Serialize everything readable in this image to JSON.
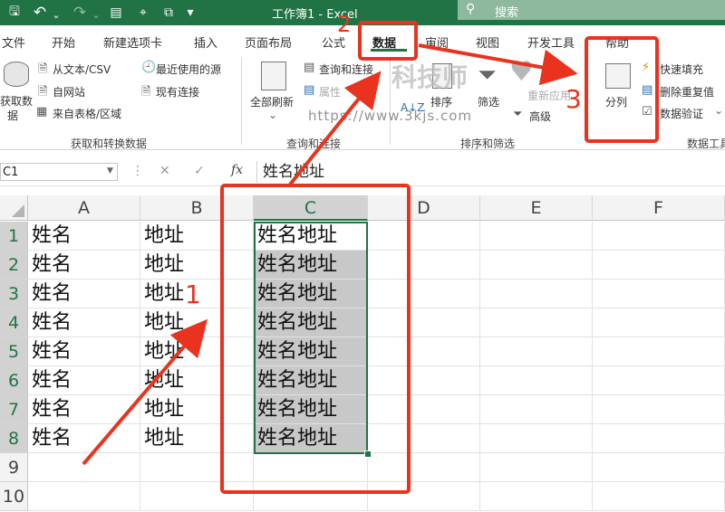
{
  "titlebar": {
    "title": "工作簿1 - Excel",
    "search_placeholder": "搜索",
    "icons": [
      "save-icon",
      "undo-icon",
      "redo-icon",
      "form-icon",
      "camera-icon",
      "screenshot-icon",
      "qat-dropdown-icon",
      "search-icon"
    ],
    "undo_glyph": "↶",
    "redo_glyph": "↷",
    "dropdown_glyph": "⌄",
    "search_glyph": "⚲",
    "save_glyph": "🖫",
    "form_glyph": "▤",
    "camera_glyph": "⌖",
    "screenshot_glyph": "⧉",
    "qat_glyph": "▾"
  },
  "tabs": [
    "文件",
    "开始",
    "新建选项卡",
    "插入",
    "页面布局",
    "公式",
    "数据",
    "审阅",
    "视图",
    "开发工具",
    "帮助"
  ],
  "active_tab": "数据",
  "ribbon": {
    "get_data": {
      "big_button": "获取数\n据",
      "big_button_line1": "获取数",
      "big_button_line2": "据",
      "from_text_csv": "从文本/CSV",
      "from_web": "自网站",
      "from_table": "来自表格/区域",
      "recent_sources": "最近使用的源",
      "existing_connections": "现有连接",
      "group_label": "获取和转换数据"
    },
    "queries": {
      "refresh_all": "全部刷新",
      "queries_connections": "查询和连接",
      "properties": "属性",
      "group_label": "查询和连接"
    },
    "sort_filter": {
      "sort": "排序",
      "filter": "筛选",
      "reapply": "重新应用",
      "advanced": "高级",
      "group_label": "排序和筛选"
    },
    "data_tools": {
      "text_to_columns": "分列",
      "flash_fill": "快速填充",
      "remove_duplicates": "删除重复值",
      "data_validation": "数据验证",
      "group_label": "数据工具"
    }
  },
  "watermark": {
    "brand": "科技师",
    "url": "https://www.3kjs.com"
  },
  "formula_bar": {
    "name_box": "C1",
    "formula": "姓名地址",
    "cancel_glyph": "✕",
    "enter_glyph": "✓",
    "fx_glyph": "fx",
    "more_glyph": "⋮"
  },
  "sheet": {
    "columns": [
      "A",
      "B",
      "C",
      "D",
      "E",
      "F"
    ],
    "rows": [
      "1",
      "2",
      "3",
      "4",
      "5",
      "6",
      "7",
      "8",
      "9",
      "10"
    ],
    "col_a": [
      "姓名",
      "姓名",
      "姓名",
      "姓名",
      "姓名",
      "姓名",
      "姓名",
      "姓名"
    ],
    "col_b": [
      "地址",
      "地址",
      "地址",
      "地址",
      "地址",
      "地址",
      "地址",
      "地址"
    ],
    "col_c": [
      "姓名地址",
      "姓名地址",
      "姓名地址",
      "姓名地址",
      "姓名地址",
      "姓名地址",
      "姓名地址",
      "姓名地址"
    ]
  },
  "annotations": {
    "step1": "1",
    "step2": "2",
    "step3": "3",
    "color": "#e9331f"
  },
  "colors": {
    "excel_green": "#217346",
    "annotation_red": "#e9331f"
  }
}
